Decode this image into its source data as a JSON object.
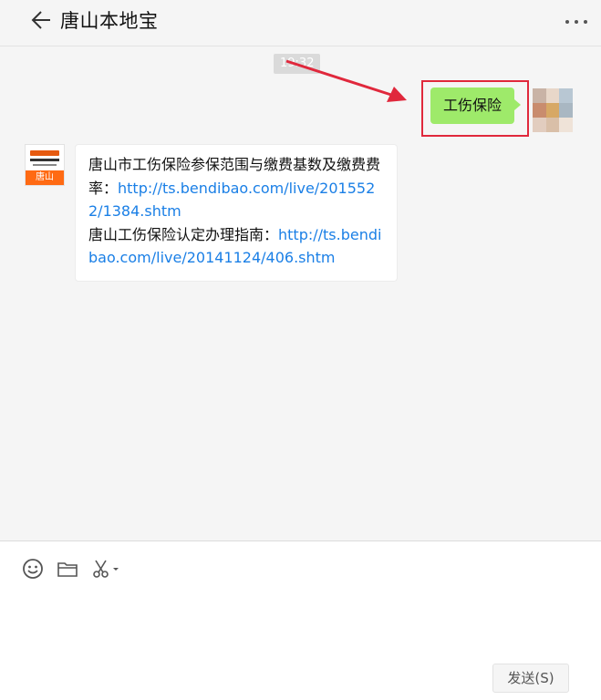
{
  "header": {
    "title": "唐山本地宝"
  },
  "chat": {
    "timestamp": "19:32",
    "sent_message": "工伤保险",
    "bot_avatar_caption": "唐山",
    "reply": {
      "line1_text": "唐山市工伤保险参保范围与缴费基数及缴费费率：",
      "line1_link": "http://ts.bendibao.com/live/2015522/1384.shtm",
      "line2_text": "唐山工伤保险认定办理指南：",
      "line2_link": "http://ts.bendibao.com/live/20141124/406.shtm"
    }
  },
  "composer": {
    "send_label": "发送(S)"
  },
  "colors": {
    "sent_bubble": "#9eea6a",
    "link": "#1a7fe6",
    "highlight": "#e0283c",
    "brand_orange": "#ff6a13"
  },
  "icons": [
    "back-arrow-icon",
    "more-icon",
    "emoji-icon",
    "folder-icon",
    "scissors-icon"
  ]
}
